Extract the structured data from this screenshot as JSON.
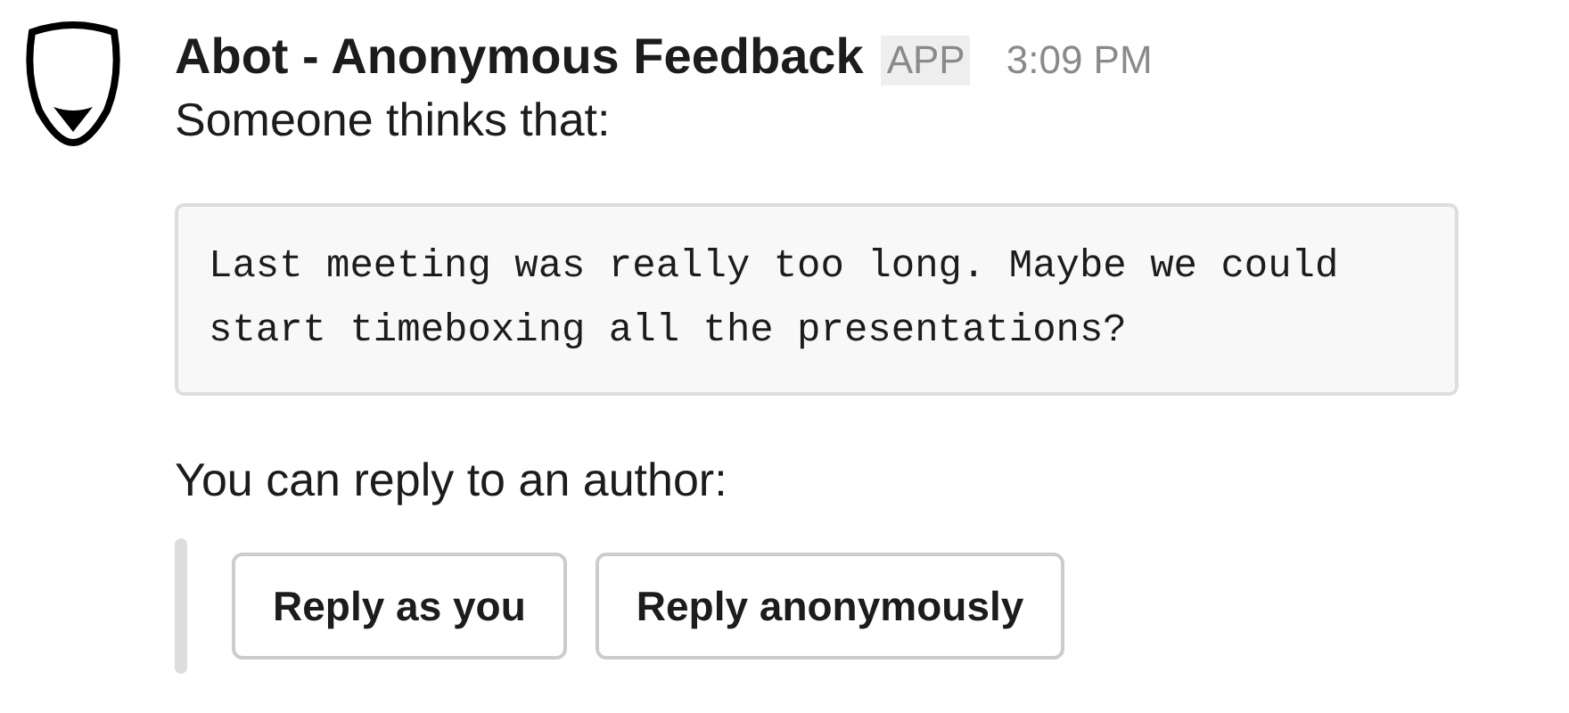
{
  "message": {
    "sender": "Abot - Anonymous Feedback",
    "badge": "APP",
    "time": "3:09 PM",
    "intro": "Someone thinks that:",
    "quote": "Last meeting was really too long. Maybe we could start timeboxing all the presentations?",
    "prompt": "You can reply to an author:",
    "buttons": [
      "Reply as you",
      "Reply anonymously"
    ]
  }
}
